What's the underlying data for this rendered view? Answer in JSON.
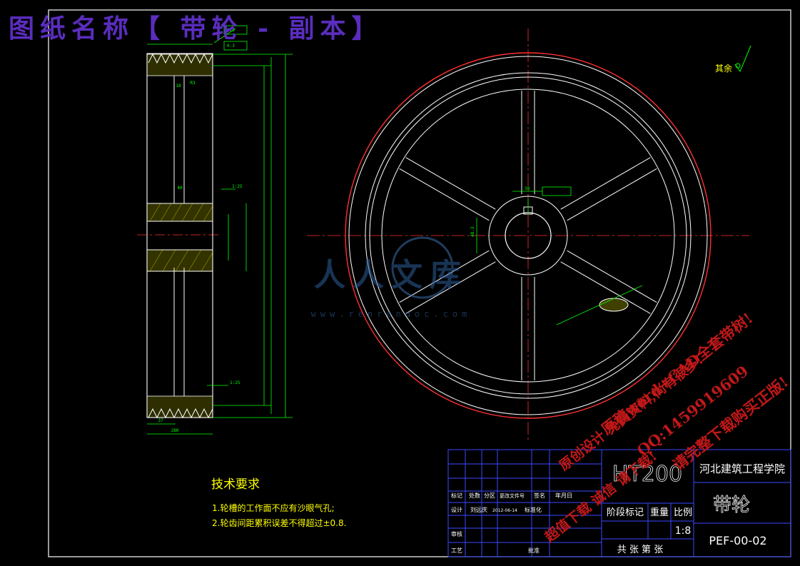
{
  "drawing_title": "图纸名称【 带轮 - 副本】",
  "surface_note": "其余",
  "watermark": {
    "brand": "人人文库",
    "url": "www.renrendoc.com",
    "promo_lines": [
      "原稿word+CAD全套带树!",
      "QQ:1459919609",
      "请完整下载购买正版!",
      "原创设计 免费资料,尚有很多!",
      "超值下载 诚信 请下载!"
    ]
  },
  "tech_requirements": {
    "heading": "技术要求",
    "items": [
      "1.轮槽的工作面不应有沙眼气孔;",
      "2.轮齿间距累积误差不得超过±0.8."
    ]
  },
  "title_block": {
    "material": "HT200",
    "school": "河北建筑工程学院",
    "part_name": "带轮",
    "header_labels": [
      "标记",
      "处数",
      "分区",
      "更改文件号",
      "签名",
      "年月日"
    ],
    "design_label": "设计",
    "designer": "刘远庆",
    "design_date": "2012-06-14",
    "std_label": "标准化",
    "review_label": "审核",
    "process_label": "工艺",
    "approve_label": "批准",
    "stage_label": "阶段标记",
    "weight_label": "重量",
    "scale_label": "比例",
    "scale_value": "1:8",
    "sheet_label": "共 张 第 张",
    "drawing_no": "PEF-00-02"
  },
  "colors": {
    "background": "#000000",
    "frame": "#ffffff",
    "outline": "#ffffff",
    "dimension": "#00ff00",
    "centerline": "#ff3030",
    "title_purple": "#5a2dbe",
    "table_blue": "#3a48ff",
    "hatch_yellow": "#ffff00",
    "watermark_red": "#c01818"
  }
}
